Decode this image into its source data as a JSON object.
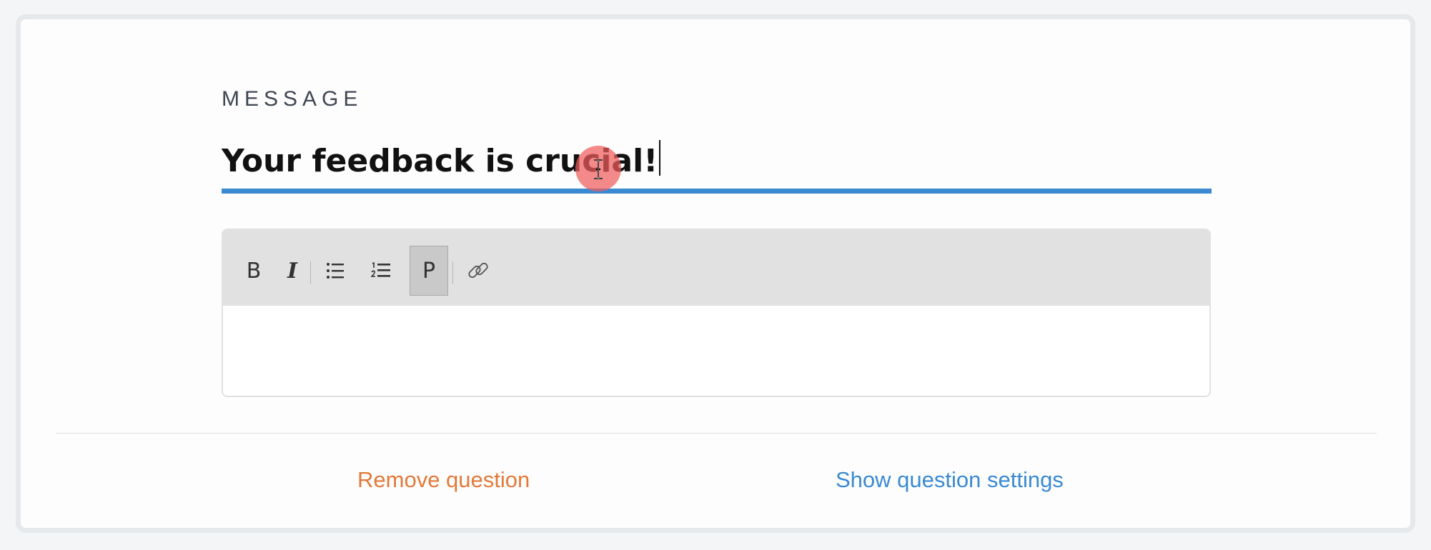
{
  "section": {
    "label": "MESSAGE"
  },
  "question": {
    "title_value": "Your feedback is crucial!"
  },
  "toolbar": {
    "bold_label": "B",
    "italic_label": "I",
    "paragraph_label": "P",
    "items": [
      "bold",
      "italic",
      "bullet-list",
      "numbered-list",
      "paragraph",
      "link"
    ]
  },
  "actions": {
    "remove_label": "Remove question",
    "settings_label": "Show question settings"
  },
  "colors": {
    "accent": "#3a8ad2",
    "danger": "#e27a3a",
    "click_marker": "#ee5c5c"
  },
  "icons": {
    "bullet_list": "bullet-list-icon",
    "numbered_list": "numbered-list-icon",
    "link": "link-icon",
    "cursor": "text-cursor-icon"
  }
}
